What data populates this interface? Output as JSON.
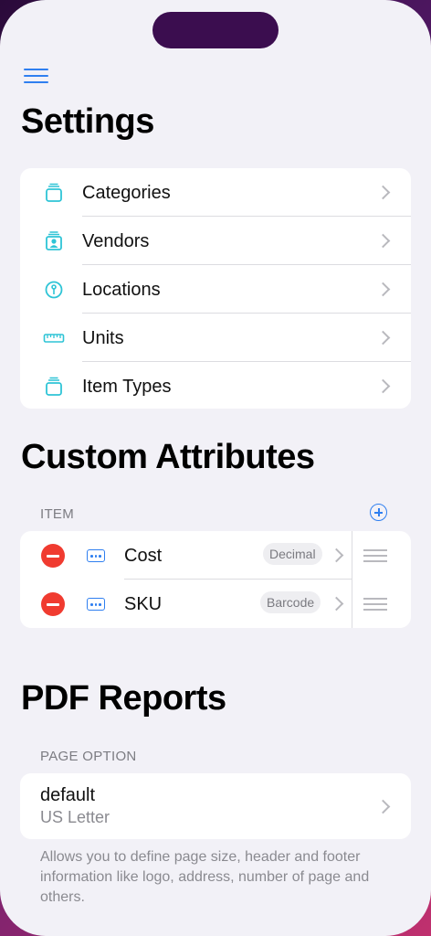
{
  "header": {
    "title": "Settings"
  },
  "settings_items": [
    {
      "label": "Categories",
      "icon": "tray-stack-icon"
    },
    {
      "label": "Vendors",
      "icon": "vendor-person-icon"
    },
    {
      "label": "Locations",
      "icon": "location-pin-icon"
    },
    {
      "label": "Units",
      "icon": "ruler-icon"
    },
    {
      "label": "Item Types",
      "icon": "tray-stack-icon"
    }
  ],
  "custom_attributes": {
    "title": "Custom Attributes",
    "section_label": "ITEM",
    "items": [
      {
        "label": "Cost",
        "type": "Decimal"
      },
      {
        "label": "SKU",
        "type": "Barcode"
      }
    ]
  },
  "pdf_reports": {
    "title": "PDF Reports",
    "section_label": "PAGE OPTION",
    "option_title": "default",
    "option_subtitle": "US Letter",
    "footnote": "Allows you to define page size, header and footer information like logo, address, number of page and others."
  },
  "colors": {
    "accent": "#2f7ff0",
    "icon_teal": "#2ec4d6",
    "delete": "#f03b30"
  }
}
